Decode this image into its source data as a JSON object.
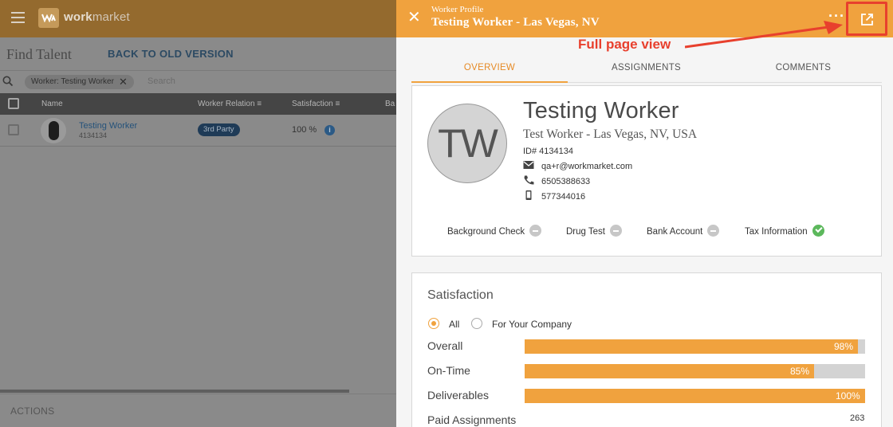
{
  "app": {
    "logo": "workmarket",
    "logo_prefix": "work",
    "logo_suffix": "market",
    "page_title": "Find Talent",
    "back_link": "BACK TO OLD VERSION",
    "search": {
      "chip": "Worker: Testing Worker",
      "placeholder": "Search"
    },
    "table": {
      "headers": [
        "Name",
        "Worker Relation",
        "Satisfaction",
        "Ba"
      ],
      "rows": [
        {
          "name": "Testing Worker",
          "id": "4134134",
          "relation": "3rd Party",
          "satisfaction": "100 %"
        }
      ]
    },
    "actions_label": "ACTIONS"
  },
  "panel": {
    "subtitle": "Worker Profile",
    "title": "Testing Worker - Las Vegas, NV",
    "more": "···",
    "annotation": "Full page view",
    "tabs": [
      "OVERVIEW",
      "ASSIGNMENTS",
      "COMMENTS"
    ],
    "active_tab": "OVERVIEW",
    "profile": {
      "initials": "TW",
      "name": "Testing Worker",
      "title": "Test Worker - Las Vegas, NV, USA",
      "id": "ID# 4134134",
      "email": "qa+r@workmarket.com",
      "phone": "6505388633",
      "mobile": "577344016",
      "checks": [
        {
          "label": "Background Check",
          "status": "none"
        },
        {
          "label": "Drug Test",
          "status": "none"
        },
        {
          "label": "Bank Account",
          "status": "none"
        },
        {
          "label": "Tax Information",
          "status": "verified"
        }
      ]
    },
    "satisfaction": {
      "title": "Satisfaction",
      "filters": [
        {
          "label": "All",
          "selected": true
        },
        {
          "label": "For Your Company",
          "selected": false
        }
      ],
      "metrics": [
        {
          "label": "Overall",
          "value": "98%",
          "fraction": 0.98
        },
        {
          "label": "On-Time",
          "value": "85%",
          "fraction": 0.85
        },
        {
          "label": "Deliverables",
          "value": "100%",
          "fraction": 1.0
        }
      ],
      "paid_assignments": {
        "label": "Paid Assignments",
        "value": "263"
      }
    }
  },
  "colors": {
    "accent": "#f0a23e",
    "annotation": "#e8402d",
    "verified": "#5cb85c"
  }
}
